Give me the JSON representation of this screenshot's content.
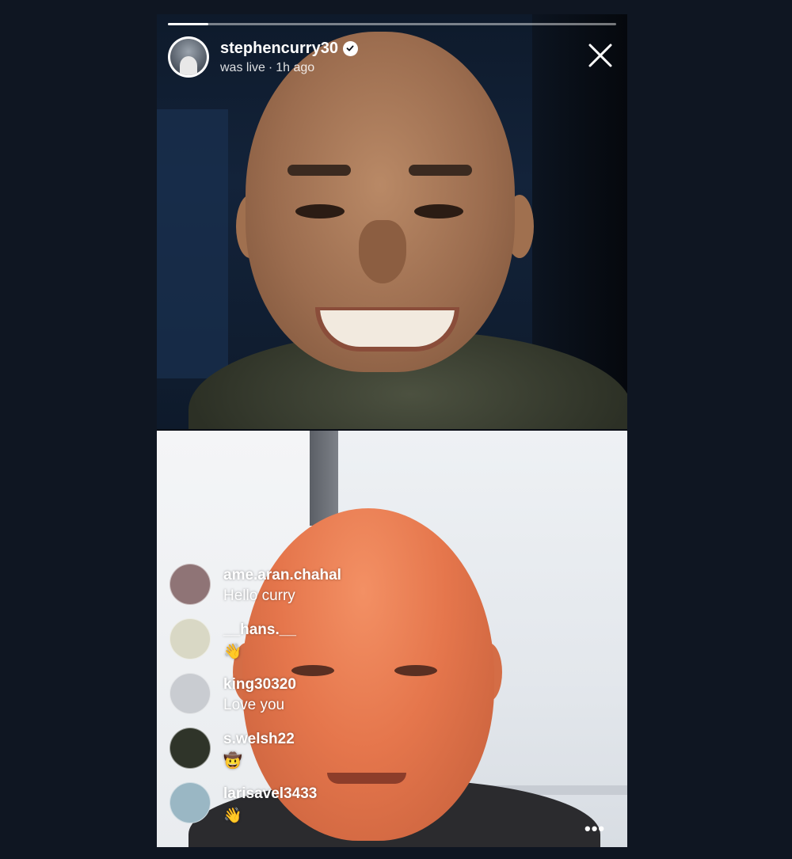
{
  "live": {
    "username": "stephencurry30",
    "verified": true,
    "status": "was live",
    "separator": "·",
    "time_ago": "1h ago",
    "progress": 0.09
  },
  "comments": [
    {
      "user": "ame.aran.chahal",
      "text": "Hello curry",
      "avatar_color": "#8f7476"
    },
    {
      "user": "__hans.__",
      "text": "👋",
      "avatar_color": "#d9d8c5"
    },
    {
      "user": "king30320",
      "text": "Love you",
      "avatar_color": "#c9ccd1"
    },
    {
      "user": "s.welsh22",
      "text": "🤠",
      "avatar_color": "#2f3429"
    },
    {
      "user": "larisavel3433",
      "text": "👋",
      "avatar_color": "#9ab7c4"
    }
  ],
  "more_label": "•••",
  "colors": {
    "background": "#0f1622",
    "verified_badge": "#ffffff",
    "text": "#ffffff"
  }
}
